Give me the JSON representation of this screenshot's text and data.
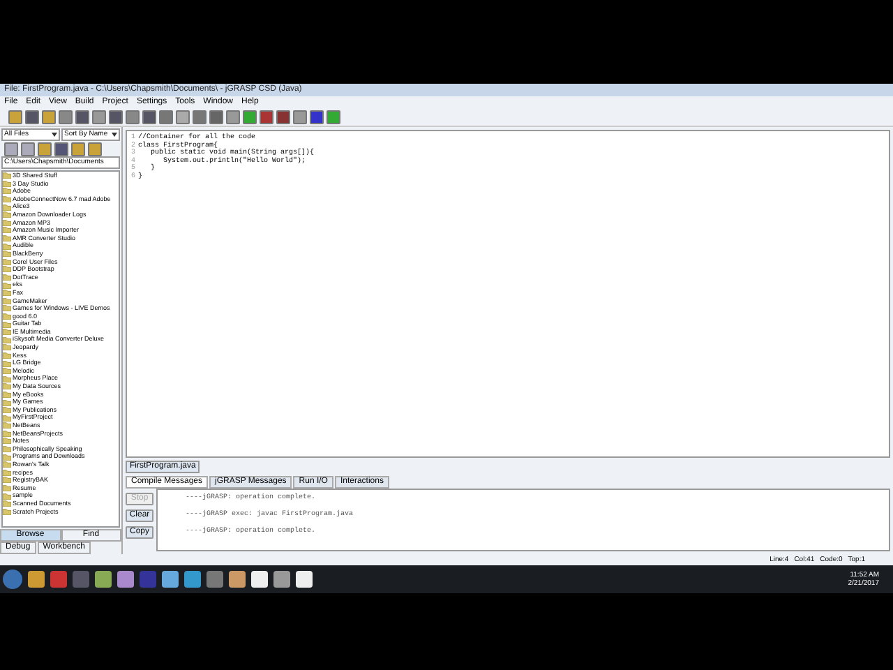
{
  "window": {
    "title": "File: FirstProgram.java - C:\\Users\\Chapsmith\\Documents\\ - jGRASP CSD (Java)"
  },
  "menu": [
    "File",
    "Edit",
    "View",
    "Build",
    "Project",
    "Settings",
    "Tools",
    "Window",
    "Help"
  ],
  "browser": {
    "filter": "All Files",
    "sort": "Sort By Name",
    "path": "C:\\Users\\Chapsmith\\Documents",
    "items": [
      "3D Shared Stuff",
      "3 Day Studio",
      "Adobe",
      "AdobeConnectNow 6.7 mad Adobe",
      "Alice3",
      "Amazon Downloader Logs",
      "Amazon MP3",
      "Amazon Music Importer",
      "AMR Converter Studio",
      "Audible",
      "BlackBerry",
      "Corel User Files",
      "DDP Bootstrap",
      "DotTrace",
      "eks",
      "Fax",
      "GameMaker",
      "Games for Windows - LIVE Demos",
      "good 6.0",
      "Guitar Tab",
      "IE Multimedia",
      "iSkysoft Media Converter Deluxe",
      "Jeopardy",
      "Kess",
      "LG Bridge",
      "Melodic",
      "Morpheus Place",
      "My Data Sources",
      "My eBooks",
      "My Games",
      "My Publications",
      "MyFirstProject",
      "NetBeans",
      "NetBeansProjects",
      "Notes",
      "Philosophically Speaking",
      "Programs and Downloads",
      "Rowan's Talk",
      "recipes",
      "RegistryBAK",
      "Resume",
      "sample",
      "Scanned Documents",
      "Scratch Projects"
    ],
    "tabs": [
      {
        "label": "Browse",
        "selected": true
      },
      {
        "label": "Find",
        "selected": false
      },
      {
        "label": "Debug",
        "selected": false
      },
      {
        "label": "Workbench",
        "selected": false
      }
    ]
  },
  "editor": {
    "lines": [
      {
        "number": "1",
        "text": "//Container for all the code"
      },
      {
        "number": "2",
        "text": "class FirstProgram{"
      },
      {
        "number": "3",
        "text": "   public static void main(String args[]){"
      },
      {
        "number": "4",
        "text": "      System.out.println(\"Hello World\");"
      },
      {
        "number": "5",
        "text": "   }"
      },
      {
        "number": "6",
        "text": "}"
      }
    ],
    "file_tab": "FirstProgram.java"
  },
  "messages": {
    "tabs": [
      {
        "label": "Compile Messages",
        "selected": true
      },
      {
        "label": "jGRASP Messages",
        "selected": false
      },
      {
        "label": "Run I/O",
        "selected": false
      },
      {
        "label": "Interactions",
        "selected": false
      }
    ],
    "buttons": [
      {
        "label": "Stop",
        "disabled": true
      },
      {
        "label": "Clear",
        "disabled": false
      },
      {
        "label": "Copy",
        "disabled": false
      }
    ],
    "lines": [
      "----jGRASP: operation complete.",
      "----jGRASP exec: javac FirstProgram.java",
      "----jGRASP: operation complete."
    ]
  },
  "status_bar": [
    "Line:4",
    "Col:41",
    "Code:0",
    "Top:1"
  ],
  "taskbar": {
    "time": "11:52 AM",
    "date": "2/21/2017"
  }
}
